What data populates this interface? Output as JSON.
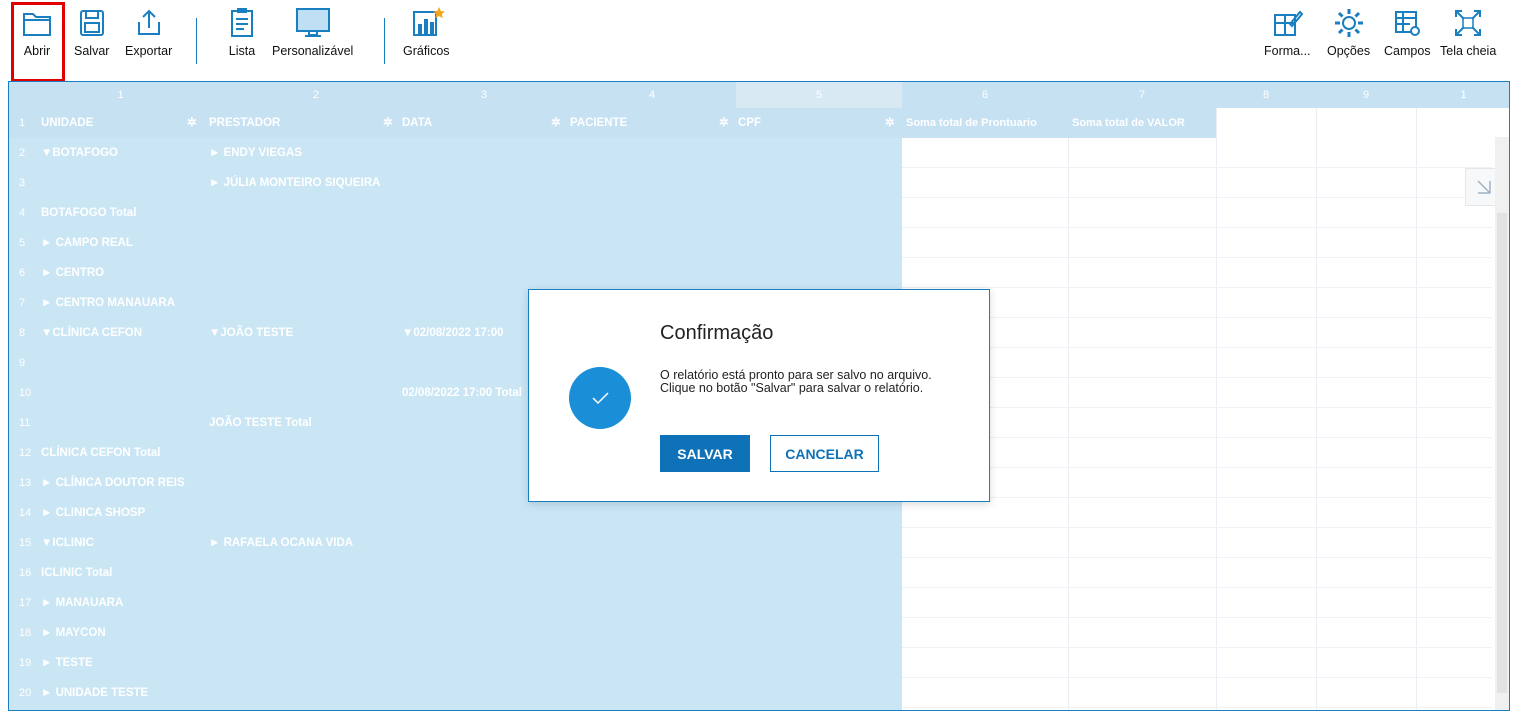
{
  "toolbar": {
    "left": [
      {
        "name": "abrir",
        "label": "Abrir",
        "icon": "folder-icon"
      },
      {
        "name": "salvar",
        "label": "Salvar",
        "icon": "floppy-disk-icon"
      },
      {
        "name": "exportar",
        "label": "Exportar",
        "icon": "export-icon"
      },
      {
        "name": "lista",
        "label": "Lista",
        "icon": "clipboard-list-icon"
      },
      {
        "name": "personalizavel",
        "label": "Personalizável",
        "icon": "monitor-icon"
      },
      {
        "name": "graficos",
        "label": "Gráficos",
        "icon": "bar-chart-icon"
      }
    ],
    "right": [
      {
        "name": "formato",
        "label": "Forma...",
        "icon": "format-grid-icon"
      },
      {
        "name": "opcoes",
        "label": "Opções",
        "icon": "gear-icon"
      },
      {
        "name": "campos",
        "label": "Campos",
        "icon": "table-gear-icon"
      },
      {
        "name": "tela-cheia",
        "label": "Tela cheia",
        "icon": "fullscreen-icon"
      }
    ]
  },
  "grid": {
    "column_numbers": [
      "1",
      "2",
      "3",
      "4",
      "5",
      "6",
      "7",
      "8",
      "9",
      "1"
    ],
    "headers": {
      "unidade": "UNIDADE",
      "prestador": "PRESTADOR",
      "data": "DATA",
      "paciente": "PACIENTE",
      "cpf": "CPF",
      "soma_prontuario": "Soma total de Prontuario",
      "soma_valor": "Soma total de VALOR"
    },
    "rows": [
      {
        "num": "2",
        "unidade": "▼BOTAFOGO",
        "prestador": "► ENDY VIEGAS",
        "data": ""
      },
      {
        "num": "3",
        "unidade": "",
        "prestador": "► JÚLIA MONTEIRO SIQUEIRA",
        "data": ""
      },
      {
        "num": "4",
        "unidade": "BOTAFOGO Total",
        "prestador": "",
        "data": ""
      },
      {
        "num": "5",
        "unidade": "► CAMPO REAL",
        "prestador": "",
        "data": ""
      },
      {
        "num": "6",
        "unidade": "► CENTRO",
        "prestador": "",
        "data": ""
      },
      {
        "num": "7",
        "unidade": "► CENTRO MANAUARA",
        "prestador": "",
        "data": ""
      },
      {
        "num": "8",
        "unidade": "▼CLÍNICA CEFON",
        "prestador": "▼JOÃO TESTE",
        "data": "▼02/08/2022 17:00"
      },
      {
        "num": "9",
        "unidade": "",
        "prestador": "",
        "data": ""
      },
      {
        "num": "10",
        "unidade": "",
        "prestador": "",
        "data": "02/08/2022 17:00 Total"
      },
      {
        "num": "11",
        "unidade": "",
        "prestador": "JOÃO TESTE Total",
        "data": ""
      },
      {
        "num": "12",
        "unidade": "CLÍNICA CEFON Total",
        "prestador": "",
        "data": ""
      },
      {
        "num": "13",
        "unidade": "► CLÍNICA DOUTOR REIS",
        "prestador": "",
        "data": ""
      },
      {
        "num": "14",
        "unidade": "► CLINICA SHOSP",
        "prestador": "",
        "data": ""
      },
      {
        "num": "15",
        "unidade": "▼ICLINIC",
        "prestador": "► RAFAELA OCANA VIDA",
        "data": ""
      },
      {
        "num": "16",
        "unidade": "ICLINIC Total",
        "prestador": "",
        "data": ""
      },
      {
        "num": "17",
        "unidade": "► MANAUARA",
        "prestador": "",
        "data": ""
      },
      {
        "num": "18",
        "unidade": "► MAYCON",
        "prestador": "",
        "data": ""
      },
      {
        "num": "19",
        "unidade": "► TESTE",
        "prestador": "",
        "data": ""
      },
      {
        "num": "20",
        "unidade": "► UNIDADE TESTE",
        "prestador": "",
        "data": ""
      }
    ]
  },
  "dialog": {
    "title": "Confirmação",
    "message": "O relatório está pronto para ser salvo no arquivo. Clique no botão \"Salvar\" para salvar o relatório.",
    "save_label": "SALVAR",
    "cancel_label": "CANCELAR"
  },
  "colors": {
    "accent": "#0f72b8",
    "grid_blue": "#cae6f5",
    "highlight": "#e00000"
  }
}
